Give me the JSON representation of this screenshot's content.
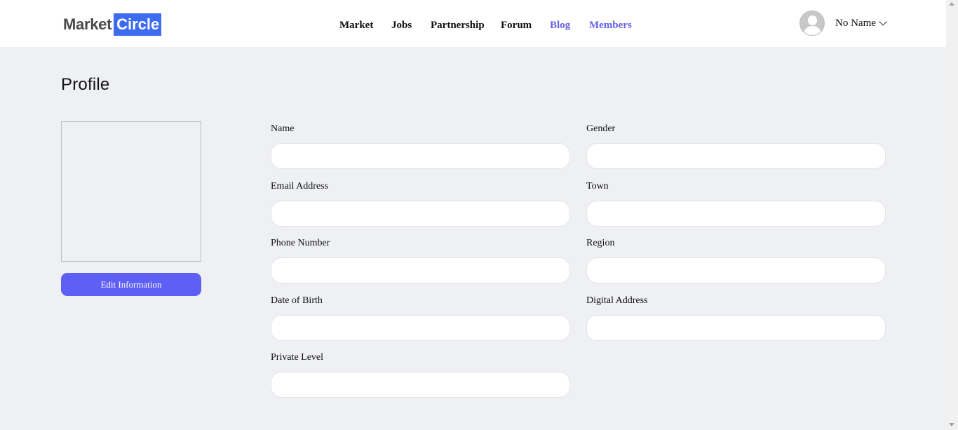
{
  "brand": {
    "part1": "Market",
    "part2": "Circle"
  },
  "nav": [
    {
      "label": "Market",
      "accent": false
    },
    {
      "label": "Jobs",
      "accent": false
    },
    {
      "label": "Partnership",
      "accent": false
    },
    {
      "label": "Forum",
      "accent": false
    },
    {
      "label": "Blog",
      "accent": true
    },
    {
      "label": "Members",
      "accent": true
    }
  ],
  "user": {
    "name": "No Name",
    "avatar_icon": "user-avatar-icon",
    "menu_icon": "chevron-down-icon"
  },
  "page": {
    "title": "Profile"
  },
  "profile": {
    "edit_label": "Edit Information"
  },
  "form": {
    "name": {
      "label": "Name",
      "value": ""
    },
    "gender": {
      "label": "Gender",
      "value": ""
    },
    "email": {
      "label": "Email Address",
      "value": ""
    },
    "town": {
      "label": "Town",
      "value": ""
    },
    "phone": {
      "label": "Phone Number",
      "value": ""
    },
    "region": {
      "label": "Region",
      "value": ""
    },
    "dob": {
      "label": "Date of Birth",
      "value": ""
    },
    "digital_address": {
      "label": "Digital Address",
      "value": ""
    },
    "private_level": {
      "label": "Private Level",
      "value": ""
    }
  },
  "colors": {
    "accent": "#6663e6",
    "button": "#5d5ff5",
    "logo_block": "#3d6cf0",
    "background": "#eff0f4"
  }
}
